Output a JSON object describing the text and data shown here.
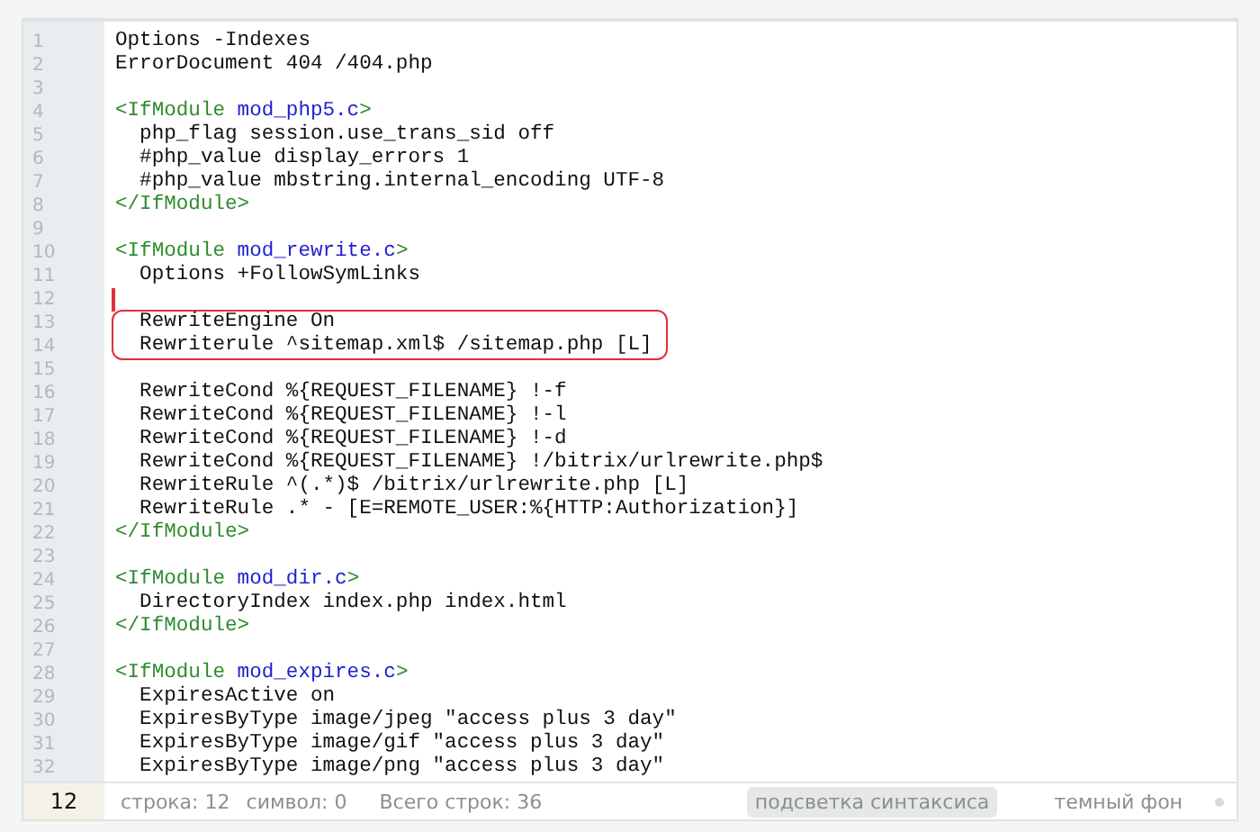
{
  "editor": {
    "lines": [
      {
        "kind": "code",
        "number": "1",
        "segments": [
          {
            "kind": "plain",
            "text": "Options -Indexes"
          }
        ]
      },
      {
        "kind": "code",
        "number": "2",
        "segments": [
          {
            "kind": "plain",
            "text": "ErrorDocument 404 /404.php"
          }
        ]
      },
      {
        "kind": "code",
        "number": "3"
      },
      {
        "kind": "code",
        "number": "4",
        "segments": [
          {
            "kind": "tag",
            "text": "<IfModule "
          },
          {
            "kind": "module",
            "text": "mod_php5.c"
          },
          {
            "kind": "tag",
            "text": ">"
          }
        ]
      },
      {
        "kind": "code",
        "number": "5",
        "segments": [
          {
            "kind": "plain",
            "text": "  php_flag session.use_trans_sid off"
          }
        ]
      },
      {
        "kind": "code",
        "number": "6",
        "segments": [
          {
            "kind": "plain",
            "text": "  #php_value display_errors 1"
          }
        ]
      },
      {
        "kind": "code",
        "number": "7",
        "segments": [
          {
            "kind": "plain",
            "text": "  #php_value mbstring.internal_encoding UTF-8"
          }
        ]
      },
      {
        "kind": "code",
        "number": "8",
        "segments": [
          {
            "kind": "tag",
            "text": "</IfModule>"
          }
        ]
      },
      {
        "kind": "code",
        "number": "9"
      },
      {
        "kind": "code",
        "number": "10",
        "segments": [
          {
            "kind": "tag",
            "text": "<IfModule "
          },
          {
            "kind": "module",
            "text": "mod_rewrite.c"
          },
          {
            "kind": "tag",
            "text": ">"
          }
        ]
      },
      {
        "kind": "code",
        "number": "11",
        "segments": [
          {
            "kind": "plain",
            "text": "  Options +FollowSymLinks"
          }
        ]
      },
      {
        "kind": "cursor",
        "number": "12"
      },
      {
        "kind": "frame",
        "lines": [
          {
            "kind": "code",
            "number": "13",
            "segments": [
              {
                "kind": "plain",
                "text": "  RewriteEngine On"
              }
            ]
          },
          {
            "kind": "code",
            "number": "14",
            "segments": [
              {
                "kind": "plain",
                "text": "  Rewriterule ^sitemap.xml$ /sitemap.php [L]"
              }
            ]
          }
        ]
      },
      {
        "kind": "code",
        "number": "15"
      },
      {
        "kind": "code",
        "number": "16",
        "segments": [
          {
            "kind": "plain",
            "text": "  RewriteCond %{REQUEST_FILENAME} !-f"
          }
        ]
      },
      {
        "kind": "code",
        "number": "17",
        "segments": [
          {
            "kind": "plain",
            "text": "  RewriteCond %{REQUEST_FILENAME} !-l"
          }
        ]
      },
      {
        "kind": "code",
        "number": "18",
        "segments": [
          {
            "kind": "plain",
            "text": "  RewriteCond %{REQUEST_FILENAME} !-d"
          }
        ]
      },
      {
        "kind": "code",
        "number": "19",
        "segments": [
          {
            "kind": "plain",
            "text": "  RewriteCond %{REQUEST_FILENAME} !/bitrix/urlrewrite.php$"
          }
        ]
      },
      {
        "kind": "code",
        "number": "20",
        "segments": [
          {
            "kind": "plain",
            "text": "  RewriteRule ^(.*)$ /bitrix/urlrewrite.php [L]"
          }
        ]
      },
      {
        "kind": "code",
        "number": "21",
        "segments": [
          {
            "kind": "plain",
            "text": "  RewriteRule .* - [E=REMOTE_USER:%{HTTP:Authorization}]"
          }
        ]
      },
      {
        "kind": "code",
        "number": "22",
        "segments": [
          {
            "kind": "tag",
            "text": "</IfModule>"
          }
        ]
      },
      {
        "kind": "code",
        "number": "23"
      },
      {
        "kind": "code",
        "number": "24",
        "segments": [
          {
            "kind": "tag",
            "text": "<IfModule "
          },
          {
            "kind": "module",
            "text": "mod_dir.c"
          },
          {
            "kind": "tag",
            "text": ">"
          }
        ]
      },
      {
        "kind": "code",
        "number": "25",
        "segments": [
          {
            "kind": "plain",
            "text": "  DirectoryIndex index.php index.html"
          }
        ]
      },
      {
        "kind": "code",
        "number": "26",
        "segments": [
          {
            "kind": "tag",
            "text": "</IfModule>"
          }
        ]
      },
      {
        "kind": "code",
        "number": "27"
      },
      {
        "kind": "code",
        "number": "28",
        "segments": [
          {
            "kind": "tag",
            "text": "<IfModule "
          },
          {
            "kind": "module",
            "text": "mod_expires.c"
          },
          {
            "kind": "tag",
            "text": ">"
          }
        ]
      },
      {
        "kind": "code",
        "number": "29",
        "segments": [
          {
            "kind": "plain",
            "text": "  ExpiresActive on"
          }
        ]
      },
      {
        "kind": "code",
        "number": "30",
        "segments": [
          {
            "kind": "plain",
            "text": "  ExpiresByType image/jpeg \"access plus 3 day\""
          }
        ]
      },
      {
        "kind": "code",
        "number": "31",
        "segments": [
          {
            "kind": "plain",
            "text": "  ExpiresByType image/gif \"access plus 3 day\""
          }
        ]
      },
      {
        "kind": "code",
        "number": "32",
        "segments": [
          {
            "kind": "plain",
            "text": "  ExpiresByType image/png \"access plus 3 day\""
          }
        ]
      }
    ]
  },
  "status_bar": {
    "current_line": "12",
    "line": "строка: 12",
    "symbol": "символ: 0",
    "total": "Всего строк: 36",
    "toggles": [
      {
        "label": "подсветка синтаксиса",
        "on": true
      },
      {
        "label": "темный фон",
        "on": false
      }
    ]
  }
}
